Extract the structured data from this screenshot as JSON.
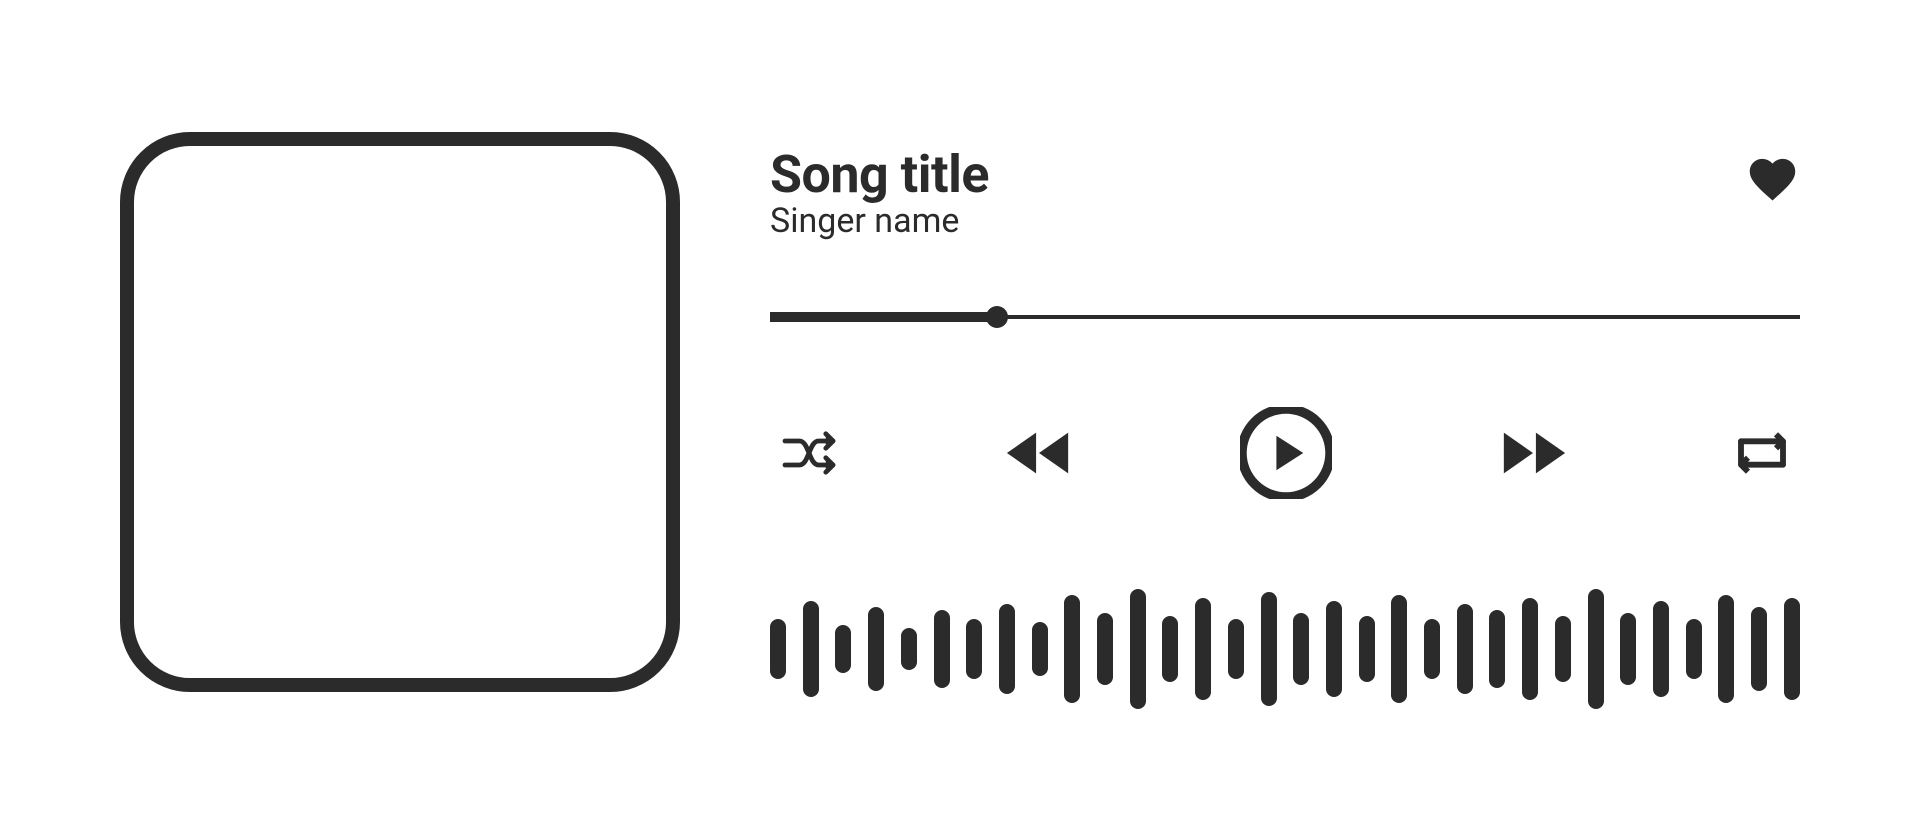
{
  "player": {
    "song_title": "Song title",
    "singer_name": "Singer name",
    "progress_percent": 22,
    "waveform_heights": [
      50,
      80,
      40,
      70,
      35,
      65,
      50,
      75,
      45,
      90,
      60,
      100,
      55,
      85,
      50,
      95,
      60,
      80,
      55,
      90,
      50,
      75,
      65,
      85,
      55,
      100,
      60,
      80,
      50,
      90,
      70,
      85
    ]
  }
}
